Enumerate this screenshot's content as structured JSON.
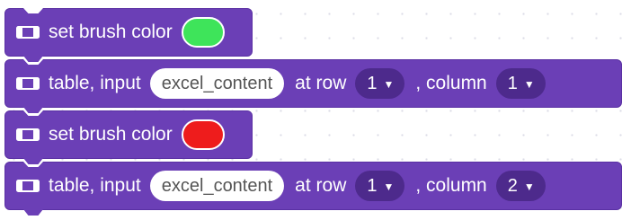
{
  "colors": {
    "block": "#6b3fb6",
    "dropdown": "#4d2a8c",
    "green": "#3ee45a",
    "red": "#ee1c1c"
  },
  "blocks": [
    {
      "type": "set-brush-color",
      "label": "set brush color",
      "color": "#3ee45a"
    },
    {
      "type": "table-input",
      "label": "table, input",
      "value": "excel_content",
      "row_label": "at row",
      "row": "1",
      "column_label": ", column",
      "column": "1",
      "arrow": "▼"
    },
    {
      "type": "set-brush-color",
      "label": "set brush color",
      "color": "#ee1c1c"
    },
    {
      "type": "table-input",
      "label": "table, input",
      "value": "excel_content",
      "row_label": "at row",
      "row": "1",
      "column_label": ", column",
      "column": "2",
      "arrow": "▼"
    }
  ]
}
